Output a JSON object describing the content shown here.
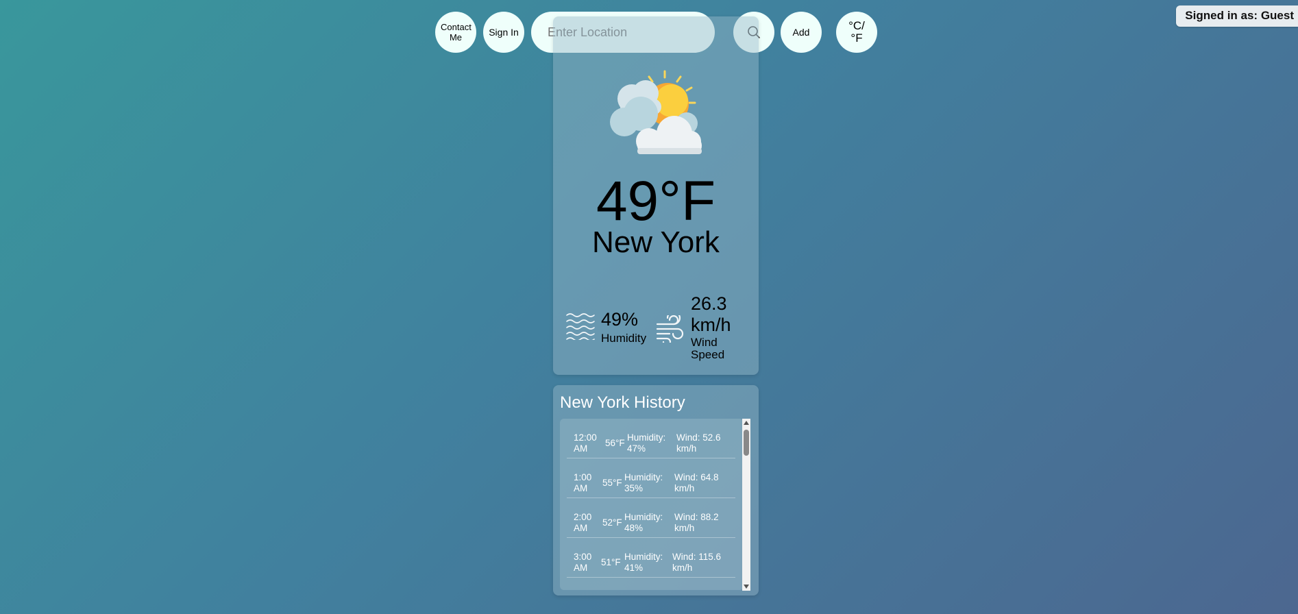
{
  "header": {
    "contact_label": "Contact Me",
    "signin_label": "Sign In",
    "search_placeholder": "Enter Location",
    "search_value": "",
    "add_label": "Add",
    "unit_toggle_label": "°C/ °F",
    "signed_in_text": "Signed in as: Guest"
  },
  "current": {
    "icon": "partly-cloudy-icon",
    "temperature": "49°F",
    "city": "New York",
    "humidity_value": "49%",
    "humidity_label": "Humidity",
    "wind_value": "26.3 km/h",
    "wind_label": "Wind Speed"
  },
  "history": {
    "title": "New York History",
    "rows": [
      {
        "time": "12:00 AM",
        "temp": "56°F",
        "humidity": "Humidity: 47%",
        "wind": "Wind: 52.6 km/h"
      },
      {
        "time": "1:00 AM",
        "temp": "55°F",
        "humidity": "Humidity: 35%",
        "wind": "Wind: 64.8 km/h"
      },
      {
        "time": "2:00 AM",
        "temp": "52°F",
        "humidity": "Humidity: 48%",
        "wind": "Wind: 88.2 km/h"
      },
      {
        "time": "3:00 AM",
        "temp": "51°F",
        "humidity": "Humidity: 41%",
        "wind": "Wind: 115.6 km/h"
      }
    ]
  },
  "colors": {
    "button_bg": "#effffb",
    "sun": "#fbbf24",
    "cloud": "#e9eef1"
  }
}
